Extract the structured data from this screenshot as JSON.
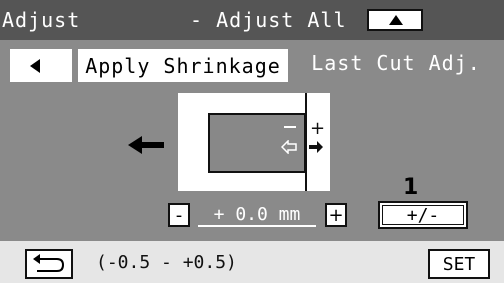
{
  "header": {
    "title_left": "Adjust",
    "title_center": "- Adjust All",
    "scroll_up_icon": "triangle-up-icon"
  },
  "tabs": {
    "prev_icon": "triangle-left-icon",
    "apply_label": "Apply Shrinkage",
    "active_label": "Last Cut Adj."
  },
  "diagram": {
    "direction_icon": "arrow-left-icon",
    "minus_sign": "−",
    "plus_sign": "+"
  },
  "adjust": {
    "minus_label": "-",
    "value": "+ 0.0 mm",
    "plus_label": "+",
    "step_number": "1",
    "toggle_label": "+/-"
  },
  "footer": {
    "back_icon": "return-arrow-icon",
    "range_text": "(-0.5 - +0.5)",
    "set_label": "SET"
  },
  "colors": {
    "panel": "#8a8a8a",
    "titlebar": "#555555",
    "footer": "#e6e6e6"
  }
}
